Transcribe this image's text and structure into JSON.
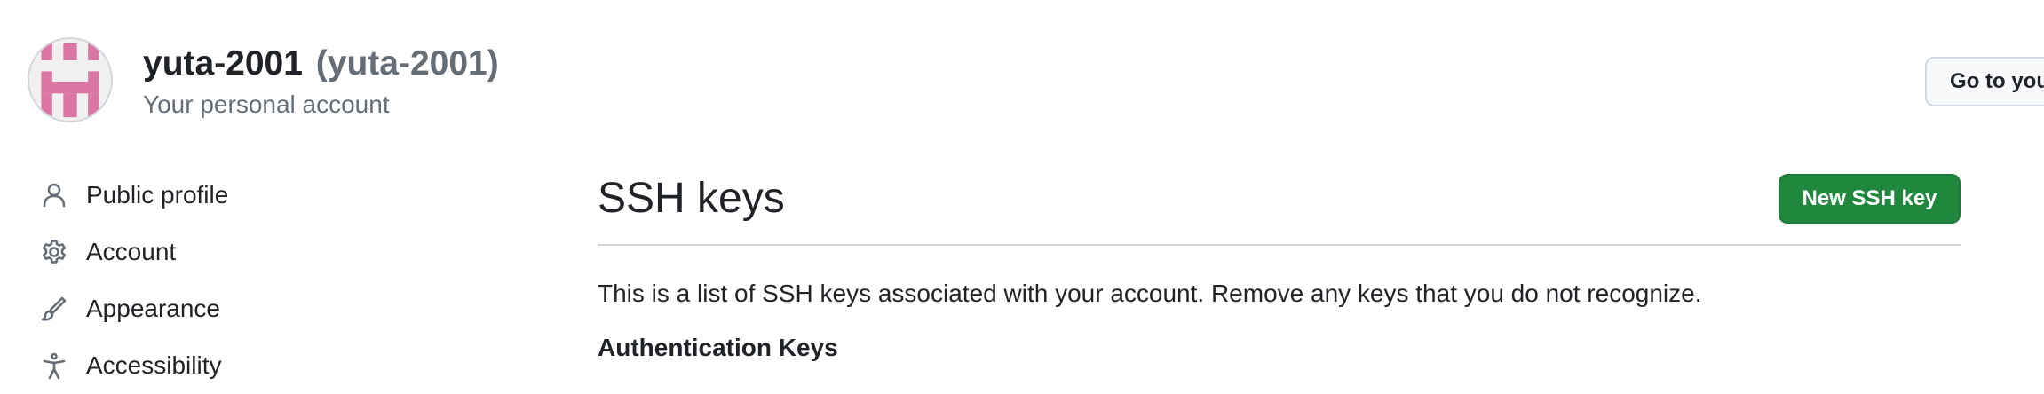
{
  "account": {
    "login": "yuta-2001",
    "handle": "(yuta-2001)",
    "subtitle": "Your personal account",
    "goto_label": "Go to you",
    "avatar_color": "#db76a3"
  },
  "sidebar": {
    "items": [
      {
        "label": "Public profile",
        "icon": "person-icon"
      },
      {
        "label": "Account",
        "icon": "gear-icon"
      },
      {
        "label": "Appearance",
        "icon": "paintbrush-icon"
      },
      {
        "label": "Accessibility",
        "icon": "accessibility-icon"
      }
    ]
  },
  "main": {
    "title": "SSH keys",
    "new_key_label": "New SSH key",
    "description": "This is a list of SSH keys associated with your account. Remove any keys that you do not recognize.",
    "section_heading": "Authentication Keys"
  },
  "colors": {
    "primary_button": "#1f883d",
    "muted_text": "#656d76",
    "border": "#d0d7de"
  }
}
